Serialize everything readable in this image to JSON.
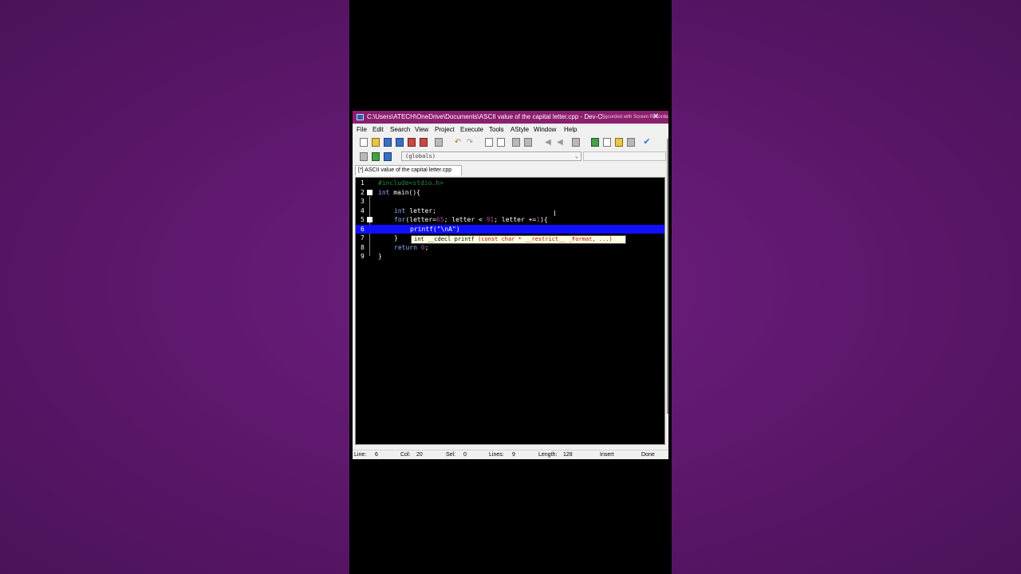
{
  "window": {
    "title": "C:\\Users\\ATECH\\OneDrive\\Documents\\ASCII value of the capital letter.cpp - Dev-C...",
    "watermark": "Recorded with Screen Recorder",
    "close_glyph": "✕"
  },
  "menu": [
    "File",
    "Edit",
    "Search",
    "View",
    "Project",
    "Execute",
    "Tools",
    "AStyle",
    "Window",
    "Help"
  ],
  "toolbar": {
    "globals_value": "(globals)",
    "chevron_glyph": "⌄"
  },
  "tab": {
    "label": "[*] ASCII value of the capital letter.cpp"
  },
  "editor": {
    "line_numbers": [
      "1",
      "2",
      "3",
      "4",
      "5",
      "6",
      "7",
      "8",
      "9"
    ],
    "lines": [
      {
        "pre": "#include<stdio.h>"
      },
      {
        "kw": "int",
        "text": " main(){"
      },
      {
        "text": ""
      },
      {
        "kw": "int",
        "text": " letter;"
      },
      {
        "kw": "for",
        "a": "(letter=",
        "n1": "65",
        "b": "; letter < ",
        "n2": "91",
        "c": "; letter +=",
        "n3": "1",
        "d": "){"
      },
      {
        "text": "printf(\"\\nA\")"
      },
      {
        "text": "}"
      },
      {
        "kw": "return",
        "n": "0",
        "text": ";"
      },
      {
        "text": "}"
      }
    ],
    "colors": {
      "background": "#000000",
      "current_line": "#1010ff",
      "preprocessor": "#1f8f3a",
      "keyword": "#8ab4ff",
      "number": "#b040b0"
    }
  },
  "tooltip": {
    "signature": "int __cdecl printf ",
    "params": "(const char * __restrict__ _Format, ...)"
  },
  "status": {
    "line_label": "Line:",
    "line_value": "6",
    "col_label": "Col:",
    "col_value": "20",
    "sel_label": "Sel:",
    "sel_value": "0",
    "lines_label": "Lines:",
    "lines_value": "9",
    "length_label": "Length:",
    "length_value": "128",
    "mode": "Insert",
    "state": "Done"
  }
}
